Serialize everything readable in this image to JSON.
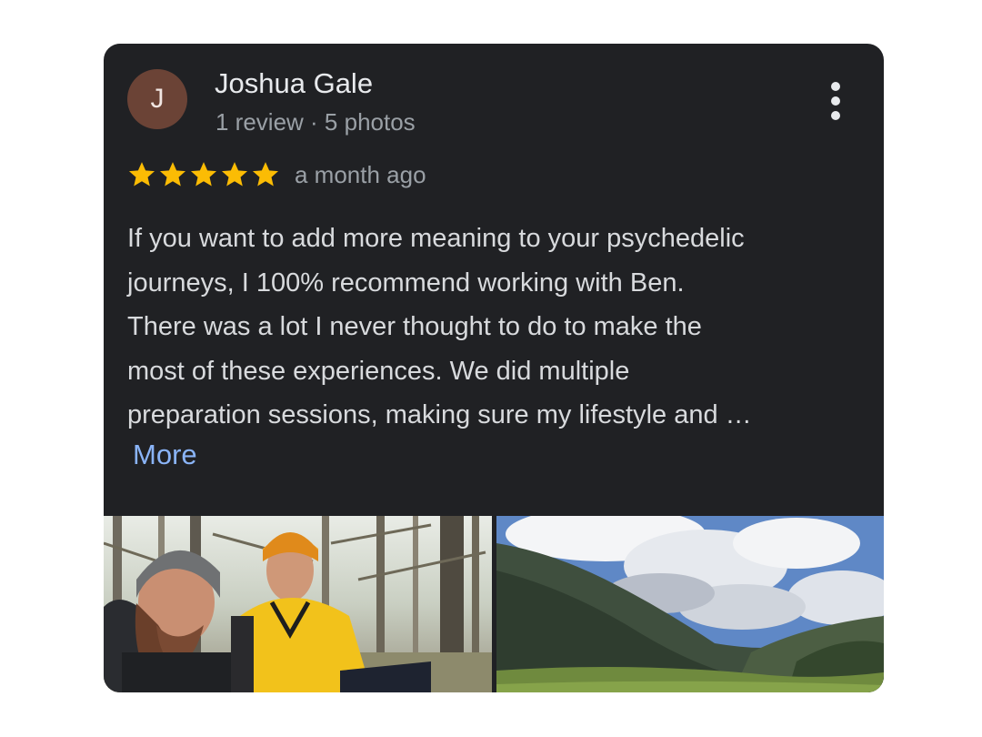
{
  "review": {
    "author_initial": "J",
    "author_name": "Joshua Gale",
    "author_meta": "1 review · 5 photos",
    "rating": 5,
    "rating_max": 5,
    "time": "a month ago",
    "text_lines": [
      "If you want to add more meaning to your psychedelic",
      "journeys, I 100% recommend working with Ben.",
      "There was a lot I never thought to do to make the",
      "most of these experiences. We did multiple",
      "preparation sessions, making sure my lifestyle and …"
    ],
    "more_label": "More",
    "menu_icon": "more-vert-icon",
    "star_icon": "star-icon",
    "photos": [
      {
        "subject": "two men selfie in forest"
      },
      {
        "subject": "green mountain valley under cloudy sky"
      }
    ]
  },
  "colors": {
    "card_bg": "#202124",
    "avatar_bg": "#6b4336",
    "star": "#fbbc04",
    "link": "#8ab4f8",
    "primary_text": "#e8eaed",
    "secondary_text": "#9aa0a6"
  }
}
